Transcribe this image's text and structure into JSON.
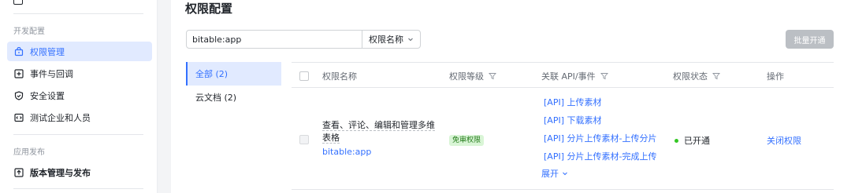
{
  "sidebar": {
    "partial_item": {
      "label": "",
      "icon": "app-icon"
    },
    "groups": [
      {
        "title": "开发配置",
        "items": [
          {
            "label": "权限管理",
            "icon": "permission-icon",
            "active": true
          },
          {
            "label": "事件与回调",
            "icon": "event-icon",
            "active": false
          },
          {
            "label": "安全设置",
            "icon": "shield-icon",
            "active": false
          },
          {
            "label": "测试企业和人员",
            "icon": "test-icon",
            "active": false
          }
        ]
      },
      {
        "title": "应用发布",
        "items": [
          {
            "label": "版本管理与发布",
            "icon": "upload-icon",
            "active": false
          }
        ]
      }
    ]
  },
  "main": {
    "title": "权限配置",
    "search": {
      "value": "bitable:app"
    },
    "filter": {
      "label": "权限名称"
    },
    "batch_button": "批量开通",
    "categories": [
      {
        "label": "全部 (2)",
        "active": true
      },
      {
        "label": "云文档 (2)",
        "active": false
      }
    ],
    "table": {
      "headers": {
        "name": "权限名称",
        "level": "权限等级",
        "api": "关联 API/事件",
        "status": "权限状态",
        "action": "操作"
      },
      "rows": [
        {
          "name_line1": "查看、评论、编辑和管理多维",
          "name_line2": "表格",
          "code": "bitable:app",
          "level_badge": "免审权限",
          "apis": [
            "[API] 上传素材",
            "[API] 下载素材",
            "[API] 分片上传素材-上传分片",
            "[API] 分片上传素材-完成上传"
          ],
          "expand_label": "展开",
          "status": "已开通",
          "status_color": "#34c724",
          "action": "关闭权限"
        }
      ]
    }
  },
  "colors": {
    "accent": "#3370ff",
    "active_bg": "#e1eaff",
    "badge_bg": "#d9f5d6",
    "badge_text": "#237b19"
  }
}
